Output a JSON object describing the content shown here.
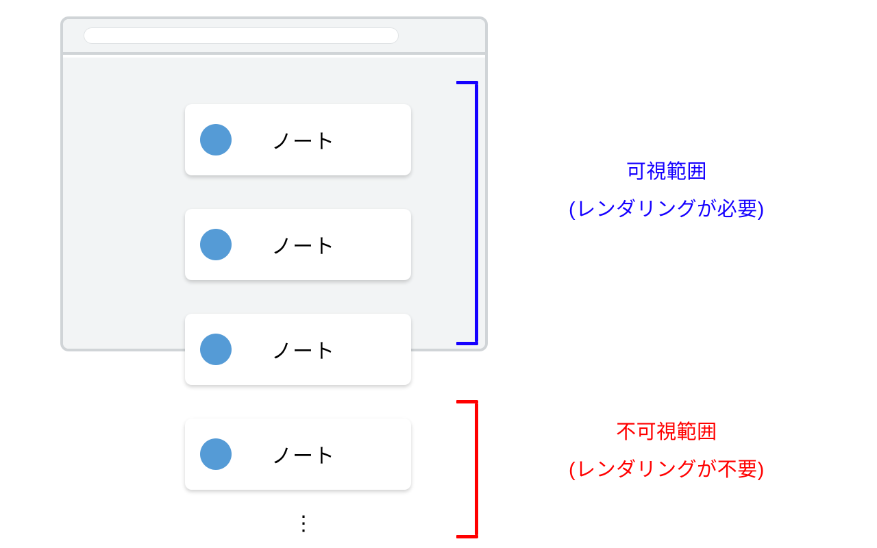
{
  "cards": [
    {
      "label": "ノート"
    },
    {
      "label": "ノート"
    },
    {
      "label": "ノート"
    },
    {
      "label": "ノート"
    }
  ],
  "ellipsis": "⋮",
  "visible": {
    "title": "可視範囲",
    "subtitle": "(レンダリングが必要)"
  },
  "invisible": {
    "title": "不可視範囲",
    "subtitle": "(レンダリングが不要)"
  }
}
